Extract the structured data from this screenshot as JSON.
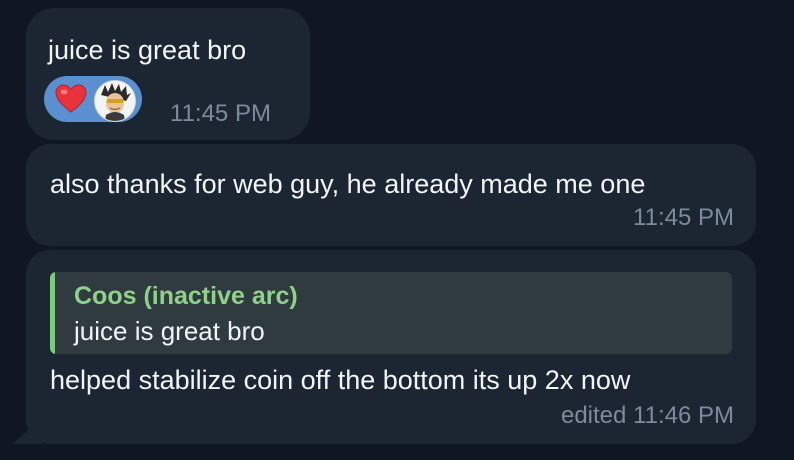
{
  "messages": [
    {
      "text": "juice is great bro",
      "time": "11:45 PM",
      "reactions": [
        {
          "icon": "heart-icon",
          "color": "#e8323c"
        },
        {
          "icon": "user-avatar-icon"
        }
      ]
    },
    {
      "text": "also thanks for web guy, he already made me one",
      "time": "11:45 PM"
    },
    {
      "reply": {
        "author": "Coos (inactive arc)",
        "text": "juice is great bro"
      },
      "text": "helped stabilize coin off the bottom its up 2x now",
      "time": "edited 11:46 PM"
    }
  ],
  "colors": {
    "background": "#0f1722",
    "bubble": "#1c2633",
    "reaction_pill": "#5a8fd0",
    "reply_accent": "#7cc97f",
    "reply_background": "#2f3b3f",
    "timestamp": "#7c8a9b"
  }
}
